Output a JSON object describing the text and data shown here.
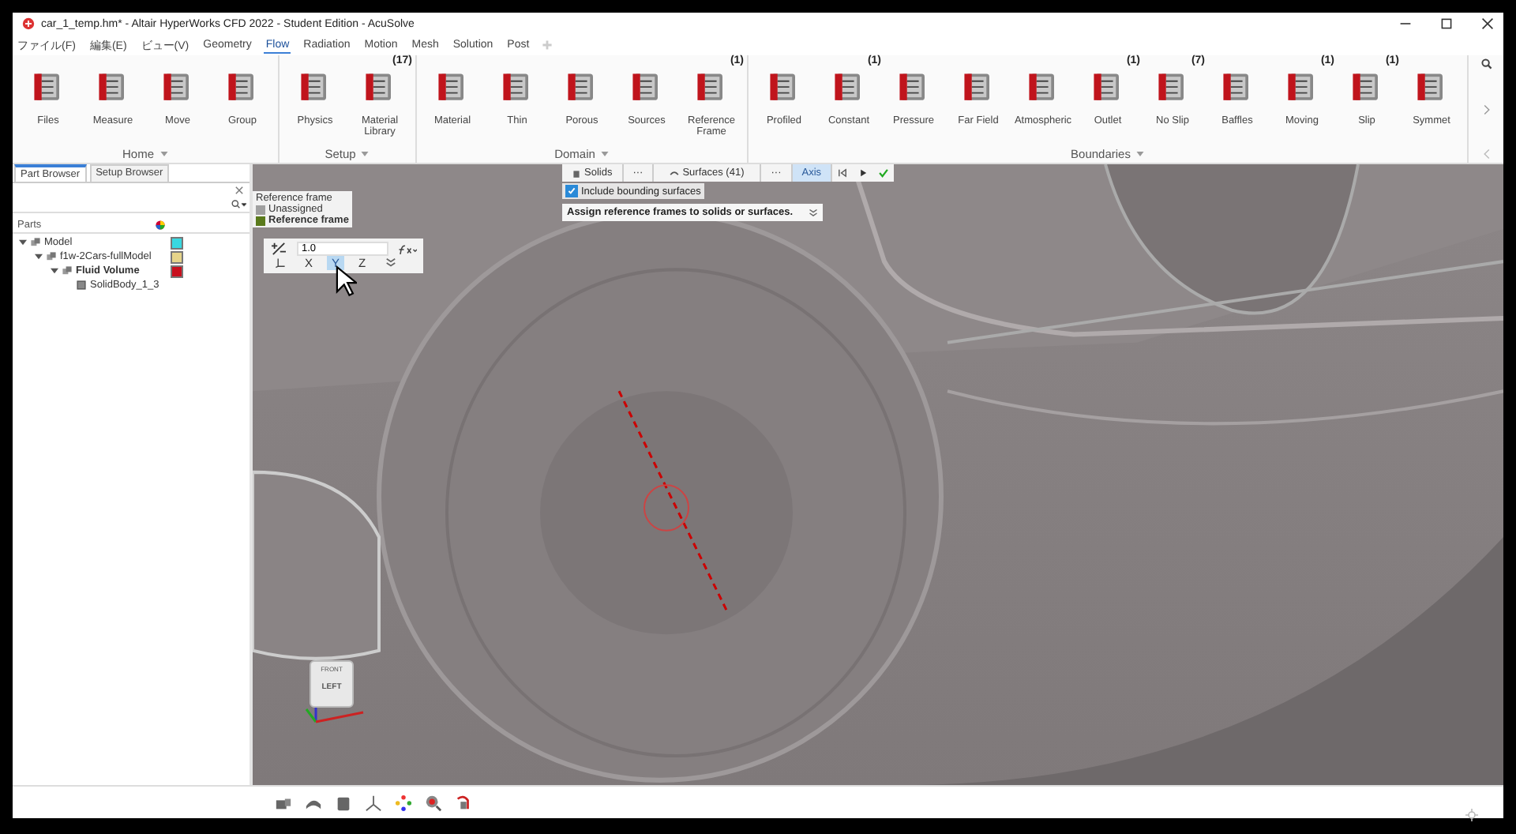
{
  "window": {
    "title": "car_1_temp.hm* - Altair HyperWorks CFD 2022 - Student Edition - AcuSolve"
  },
  "menu": [
    {
      "label": "ファイル(F)",
      "selected": false
    },
    {
      "label": "編集(E)",
      "selected": false
    },
    {
      "label": "ビュー(V)",
      "selected": false
    },
    {
      "label": "Geometry",
      "selected": false
    },
    {
      "label": "Flow",
      "selected": true
    },
    {
      "label": "Radiation",
      "selected": false
    },
    {
      "label": "Motion",
      "selected": false
    },
    {
      "label": "Mesh",
      "selected": false
    },
    {
      "label": "Solution",
      "selected": false
    },
    {
      "label": "Post",
      "selected": false
    }
  ],
  "ribbon": [
    {
      "label": "Home",
      "tools": [
        {
          "label": "Files"
        },
        {
          "label": "Measure"
        },
        {
          "label": "Move"
        },
        {
          "label": "Group"
        }
      ]
    },
    {
      "label": "Setup",
      "tools": [
        {
          "label": "Physics"
        },
        {
          "label": "Material Library",
          "badge": "(17)"
        }
      ]
    },
    {
      "label": "Domain",
      "tools": [
        {
          "label": "Material"
        },
        {
          "label": "Thin"
        },
        {
          "label": "Porous"
        },
        {
          "label": "Sources"
        },
        {
          "label": "Reference Frame",
          "badge": "(1)"
        }
      ]
    },
    {
      "label": "Boundaries",
      "tools": [
        {
          "label": "Profiled"
        },
        {
          "label": "Constant",
          "badge": "(1)"
        },
        {
          "label": "Pressure"
        },
        {
          "label": "Far Field"
        },
        {
          "label": "Atmospheric"
        },
        {
          "label": "Outlet",
          "badge": "(1)"
        },
        {
          "label": "No Slip",
          "badge": "(7)"
        },
        {
          "label": "Baffles"
        },
        {
          "label": "Moving",
          "badge": "(1)"
        },
        {
          "label": "Slip",
          "badge": "(1)"
        },
        {
          "label": "Symmet"
        }
      ]
    }
  ],
  "browser": {
    "tabs": [
      {
        "label": "Part Browser",
        "selected": true
      },
      {
        "label": "Setup Browser",
        "selected": false
      }
    ],
    "header": "Parts",
    "tree": [
      {
        "label": "Model",
        "color": "#38d8e0",
        "bold": false,
        "expanded": true,
        "children": [
          {
            "label": "f1w-2Cars-fullModel",
            "color": "#e6d48a",
            "bold": false,
            "expanded": true,
            "children": [
              {
                "label": "Fluid Volume",
                "color": "#c8101e",
                "bold": true,
                "expanded": true,
                "children": [
                  {
                    "label": "SolidBody_1_3",
                    "bold": false
                  }
                ]
              }
            ]
          }
        ]
      }
    ]
  },
  "legend": {
    "title": "Reference frame",
    "items": [
      {
        "label": "Unassigned",
        "color": "#a0a0a0",
        "selected": false
      },
      {
        "label": "Reference frame",
        "color": "#5a7a1c",
        "selected": true
      }
    ]
  },
  "axis_tool": {
    "value": "1.0",
    "axes": [
      {
        "label": "X",
        "selected": false
      },
      {
        "label": "Y",
        "selected": true
      },
      {
        "label": "Z",
        "selected": false
      }
    ]
  },
  "selector": {
    "solids": "Solids",
    "more": "···",
    "surfaces": "Surfaces (41)",
    "more_2": "···",
    "axis": {
      "label": "Axis",
      "selected": true
    },
    "include_bounding": {
      "label": "Include bounding surfaces",
      "checked": true
    },
    "hint": "Assign reference frames to solids or surfaces."
  },
  "view_cube": {
    "top": "FRONT",
    "face": "LEFT"
  }
}
